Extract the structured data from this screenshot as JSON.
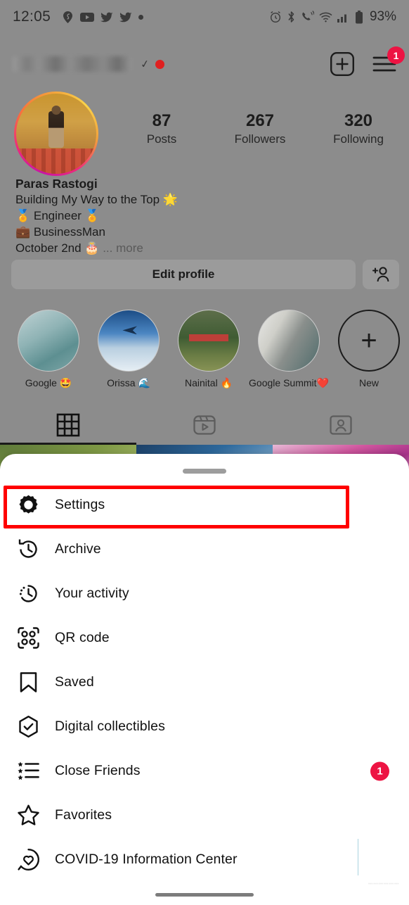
{
  "status_bar": {
    "time": "12:05",
    "left_icons": [
      "pin-icon",
      "youtube-icon",
      "twitter-icon",
      "twitter-icon",
      "dot-icon"
    ],
    "right_icons": [
      "alarm-icon",
      "bluetooth-icon",
      "phone-vibrate-icon",
      "wifi-icon",
      "signal-icon",
      "battery-icon"
    ],
    "battery_text": "93%"
  },
  "profile": {
    "username": "",
    "username_hidden": true,
    "verified_mark": "✓",
    "header_actions": {
      "add_label": "add-post",
      "menu_label": "menu",
      "menu_badge": "1"
    },
    "stats": [
      {
        "number": "87",
        "label": "Posts"
      },
      {
        "number": "267",
        "label": "Followers"
      },
      {
        "number": "320",
        "label": "Following"
      }
    ],
    "bio": {
      "name": "Paras Rastogi",
      "lines": [
        "Building My Way to the Top 🌟",
        "🏅 Engineer 🏅",
        "💼 BusinessMan"
      ],
      "last_line": "October 2nd 🎂",
      "more_label": "... more"
    },
    "buttons": {
      "edit_profile": "Edit profile",
      "add_person": "add-person-icon"
    },
    "highlights": [
      {
        "label": "Google 🤩",
        "swatch": "g1"
      },
      {
        "label": "Orissa 🌊",
        "swatch": "g2"
      },
      {
        "label": "Nainital 🔥",
        "swatch": "g3"
      },
      {
        "label": "Google Summit❤️",
        "swatch": "g4"
      },
      {
        "label": "New",
        "swatch": "new"
      }
    ],
    "tabs": [
      {
        "name": "grid-tab",
        "active": true
      },
      {
        "name": "reels-tab",
        "active": false
      },
      {
        "name": "tagged-tab",
        "active": false
      }
    ]
  },
  "sheet": {
    "handle": "drag-handle",
    "menu_items": [
      {
        "label": "Settings",
        "icon": "gear-icon",
        "badge": "",
        "highlighted": true
      },
      {
        "label": "Archive",
        "icon": "archive-clock-icon",
        "badge": "",
        "highlighted": false
      },
      {
        "label": "Your activity",
        "icon": "activity-clock-icon",
        "badge": "",
        "highlighted": false
      },
      {
        "label": "QR code",
        "icon": "qr-code-icon",
        "badge": "",
        "highlighted": false
      },
      {
        "label": "Saved",
        "icon": "bookmark-icon",
        "badge": "",
        "highlighted": false
      },
      {
        "label": "Digital collectibles",
        "icon": "shield-check-icon",
        "badge": "",
        "highlighted": false
      },
      {
        "label": "Close Friends",
        "icon": "close-friends-list-icon",
        "badge": "1",
        "highlighted": false
      },
      {
        "label": "Favorites",
        "icon": "star-icon",
        "badge": "",
        "highlighted": false
      },
      {
        "label": "COVID-19 Information Center",
        "icon": "heart-circle-icon",
        "badge": "",
        "highlighted": false
      }
    ]
  },
  "colors": {
    "highlight_red": "#ff0000",
    "badge_red": "#ed1443",
    "sheet_bg": "#ffffff",
    "dim_overlay": "#8c8c8c"
  },
  "watermark": {
    "text": "………………"
  }
}
